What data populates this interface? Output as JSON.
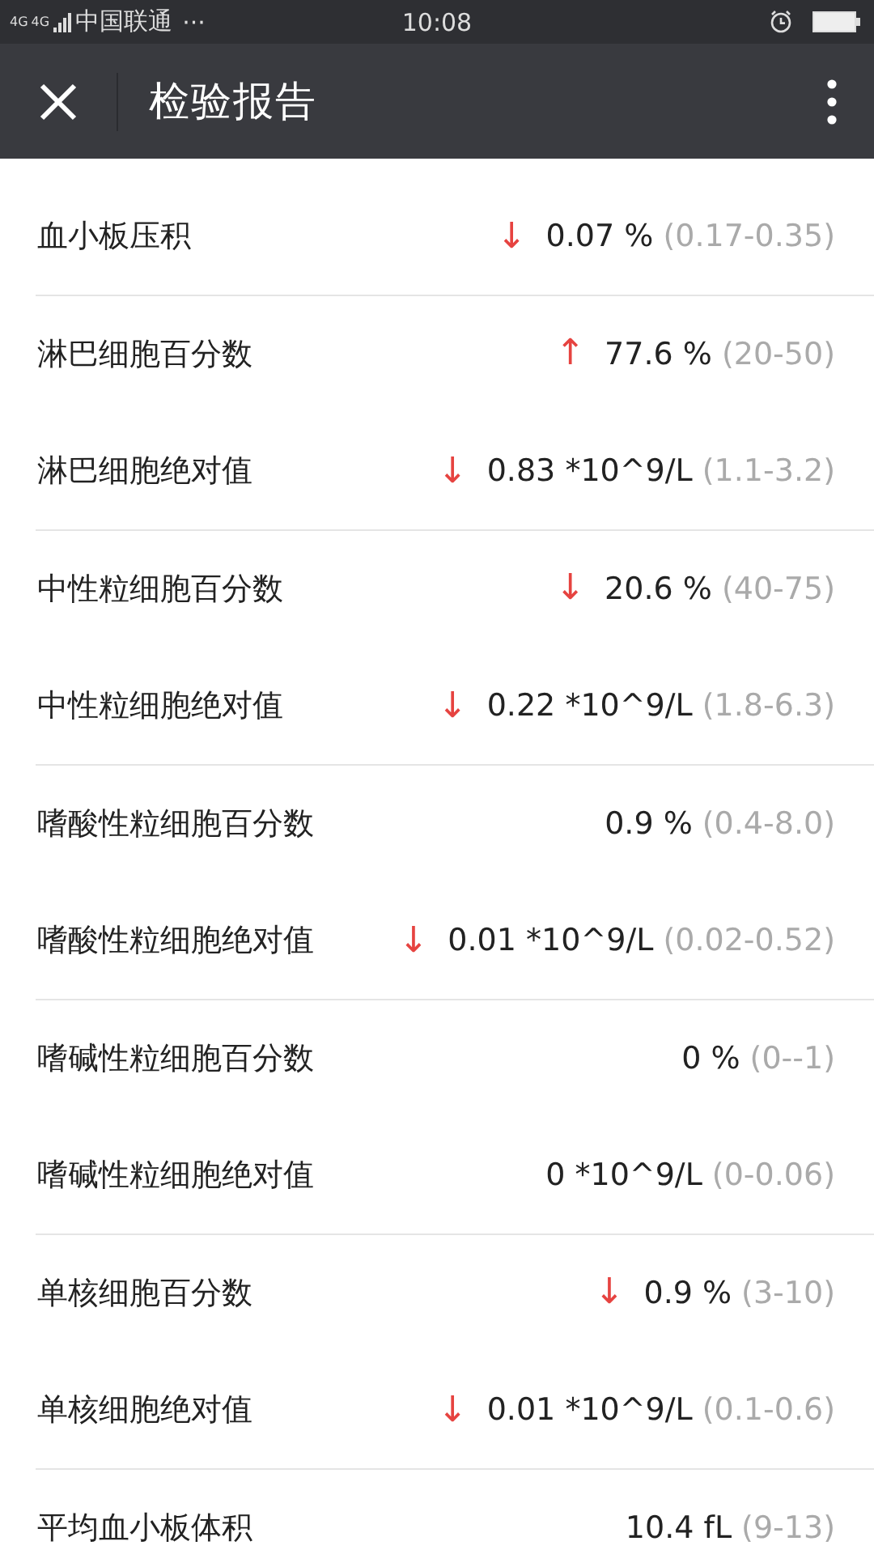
{
  "status_bar": {
    "network": "4G",
    "network_2": "4G",
    "carrier": "中国联通",
    "more": "···",
    "time": "10:08"
  },
  "nav_bar": {
    "title": "检验报告"
  },
  "results": [
    {
      "name": "血小板压积",
      "arrow": "↓",
      "value": "0.07 %",
      "range": "(0.17-0.35)",
      "divider": true
    },
    {
      "name": "淋巴细胞百分数",
      "arrow": "↑",
      "value": "77.6 %",
      "range": "(20-50)",
      "divider": false
    },
    {
      "name": "淋巴细胞绝对值",
      "arrow": "↓",
      "value": "0.83 *10^9/L",
      "range": "(1.1-3.2)",
      "divider": true
    },
    {
      "name": "中性粒细胞百分数",
      "arrow": "↓",
      "value": "20.6 %",
      "range": "(40-75)",
      "divider": false
    },
    {
      "name": "中性粒细胞绝对值",
      "arrow": "↓",
      "value": "0.22 *10^9/L",
      "range": "(1.8-6.3)",
      "divider": true
    },
    {
      "name": "嗜酸性粒细胞百分数",
      "value": "0.9 %",
      "range": "(0.4-8.0)",
      "divider": false
    },
    {
      "name": "嗜酸性粒细胞绝对值",
      "arrow": "↓",
      "value": "0.01 *10^9/L",
      "range": "(0.02-0.52)",
      "divider": true
    },
    {
      "name": "嗜碱性粒细胞百分数",
      "value": "0 %",
      "range": "(0--1)",
      "divider": false
    },
    {
      "name": "嗜碱性粒细胞绝对值",
      "value": "0 *10^9/L",
      "range": "(0-0.06)",
      "divider": true
    },
    {
      "name": "单核细胞百分数",
      "arrow": "↓",
      "value": "0.9 %",
      "range": "(3-10)",
      "divider": false
    },
    {
      "name": "单核细胞绝对值",
      "arrow": "↓",
      "value": "0.01 *10^9/L",
      "range": "(0.1-0.6)",
      "divider": true
    },
    {
      "name": "平均血小板体积",
      "value": "10.4 fL",
      "range": "(9-13)",
      "divider": false
    }
  ]
}
